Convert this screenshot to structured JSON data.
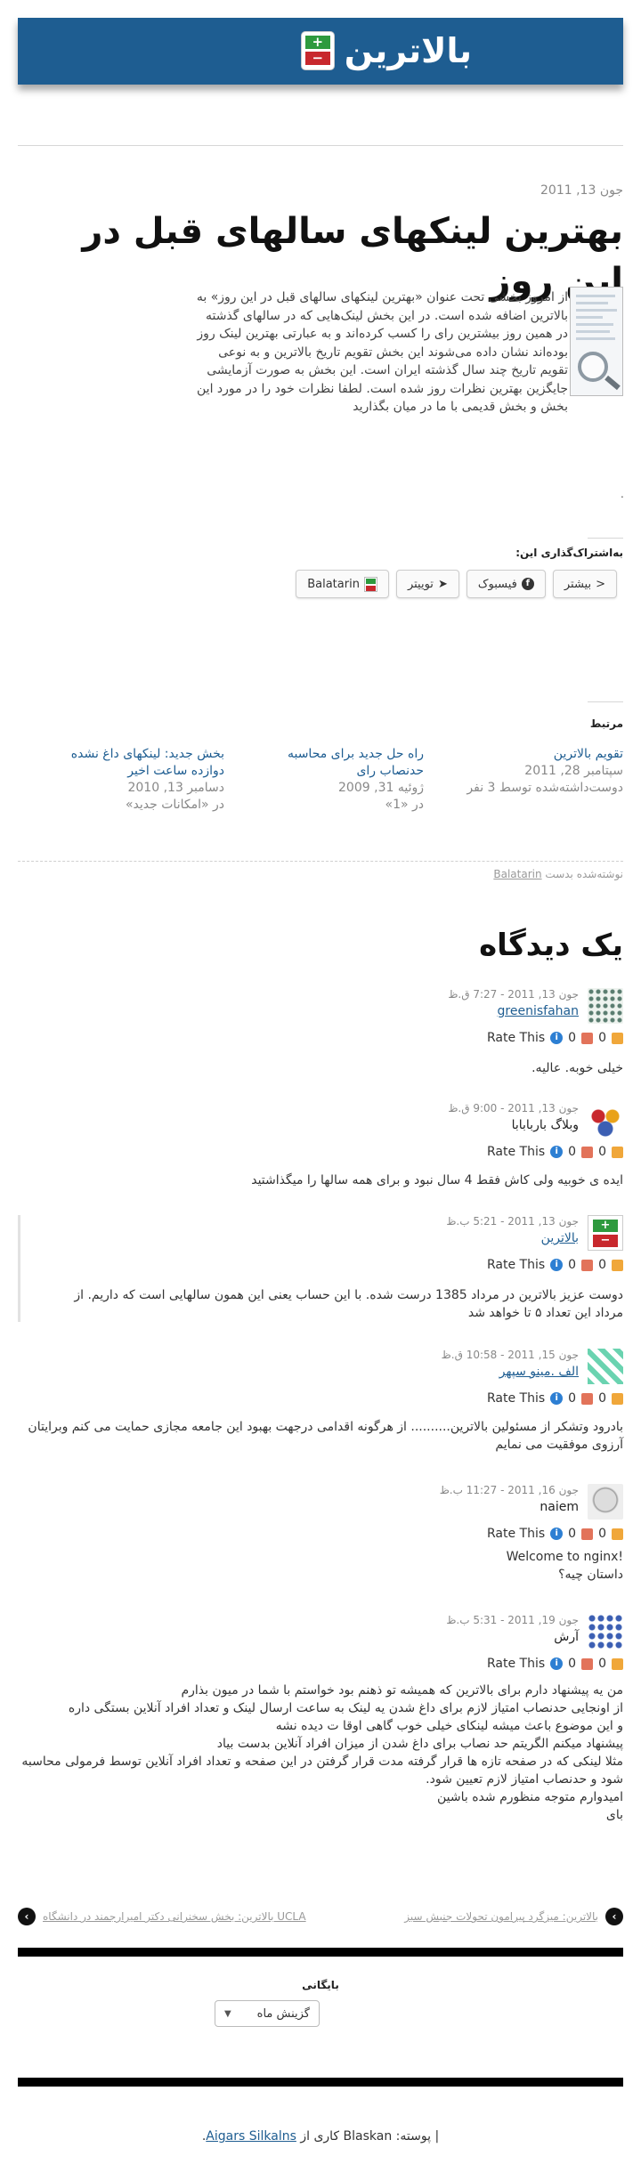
{
  "site": {
    "title": "بالاترین",
    "logo_plus": "+",
    "logo_minus": "−"
  },
  "post": {
    "date": "جون 13, 2011",
    "title": "بهترین لینکهای سالهای قبل در این روز",
    "body": "از امروز بخشی تحت عنوان «بهترین لینکهای سالهای قبل در این روز» به بالاترین اضافه شده است. در این بخش لینک‌هایی که در سالهای گذشته در همین روز بیشترین رای را کسب کرده‌اند و به عبارتی بهترین لینک روز بوده‌اند نشان داده می‌شوند این بخش تقویم تاریخ بالاترین و به نوعی تقویم تاریخ چند سال گذشته ایران است. این بخش به صورت آزمایشی جایگزین بهترین نظرات روز شده است. لطفا نظرات خود را در مورد این بخش و بخش قدیمی با ما در میان بگذارید",
    "dot": "."
  },
  "share": {
    "heading": "به‌اشتراک‌گذاری این:",
    "buttons": [
      {
        "label": "بیشتر",
        "icon": "share-icon"
      },
      {
        "label": "فیسبوک",
        "icon": "facebook-icon"
      },
      {
        "label": "توییتر",
        "icon": "twitter-icon"
      },
      {
        "label": "Balatarin",
        "icon": "balatarin-icon"
      }
    ]
  },
  "related": {
    "heading": "مرتبط",
    "items": [
      {
        "title": "تقویم بالاترین",
        "date": "سپتامبر 28, 2011",
        "context": "دوست‌داشته‌شده توسط 3 نفر"
      },
      {
        "title": "راه حل جدید برای محاسبه حدنصاب رای",
        "date": "ژوئیه 31, 2009",
        "context": "در «1»"
      },
      {
        "title": "بخش جدید: لینکهای داغ نشده دوازده ساعت اخیر",
        "date": "دسامبر 13, 2010",
        "context": "در «امکانات جدید»"
      }
    ]
  },
  "byline": {
    "prefix": "نوشته‌شده بدست",
    "author": "Balatarin"
  },
  "comments_heading": "یک دیدگاه",
  "rating_label": "Rate This",
  "comments": [
    {
      "meta": "جون 13, 2011 - 7:27 ق.ظ",
      "author": "greenisfahan",
      "up": "0",
      "down": "0",
      "text": "خیلی خوبه. عالیه."
    },
    {
      "meta": "جون 13, 2011 - 9:00 ق.ظ",
      "author": "وبلاگ باربابابا",
      "up": "0",
      "down": "0",
      "text": "ایده ی خوبیه ولی کاش فقط 4 سال نبود و برای همه سالها را میگذاشتید"
    },
    {
      "meta": "جون 13, 2011 - 5:21 ب.ظ",
      "author": "بالاترین",
      "up": "0",
      "down": "0",
      "text": "دوست عزیز بالاترین در مرداد 1385 درست شده. با این حساب یعنی این همون سالهایی است که داریم. از مرداد این تعداد ۵ تا خواهد شد"
    },
    {
      "meta": "جون 15, 2011 - 10:58 ق.ظ",
      "author": "الف .مینو سپهر",
      "up": "0",
      "down": "0",
      "text": "بادرود وتشکر از مسئولین بالاترین.......... از هرگونه اقدامی درجهت بهبود این جامعه مجازی حمایت می کنم وبرایتان آرزوی موفقیت می نمایم"
    },
    {
      "meta": "جون 16, 2011 - 11:27 ب.ظ",
      "author": "naiem",
      "up": "0",
      "down": "0",
      "line1": "!Welcome to nginx",
      "line2": "داستان چیه؟"
    },
    {
      "meta": "جون 19, 2011 - 5:31 ب.ظ",
      "author": "آرش",
      "up": "0",
      "down": "0",
      "lines": [
        "من یه پیشنهاد دارم برای بالاترین که همیشه تو ذهنم بود خواستم با شما در میون بذارم",
        "از اونجایی حدنصاب امتیاز لازم برای داغ شدن یه لینک به ساعت ارسال لینک و تعداد افراد آنلاین بستگی داره",
        "و این موضوع باعث میشه لینکای خیلی خوب گاهی اوقا ت دیده نشه",
        "پیشنهاد میکنم الگریتم حد نصاب برای داغ شدن از میزان افراد آنلاین بدست بیاد",
        "مثلا لینکی که در صفحه تازه ها قرار گرفته مدت قرار گرفتن در این صفحه و تعداد افراد آنلاین توسط فرمولی محاسبه شود و حدنصاب امتیاز لازم تعیین شود.",
        "امیدوارم متوجه منظورم شده باشین",
        "بای"
      ]
    }
  ],
  "nav": {
    "prev": "بالاترین: میزگرد پیرامون تحولات جنبش سبز",
    "next": "بالاترین: بخش سخنرانی دکتر امیرارجمند در دانشگاه UCLA"
  },
  "archive": {
    "heading": "بایگانی",
    "select_value": "گزینش ماه"
  },
  "footer": {
    "prefix": "| پوسته: Blaskan کاری از",
    "author": "Aigars Silkalns",
    "suffix": "."
  },
  "colors": {
    "header_bg": "#1e5d91",
    "link": "#1e5d91",
    "logo_green": "#2e9a3e",
    "logo_red": "#c8282d"
  }
}
